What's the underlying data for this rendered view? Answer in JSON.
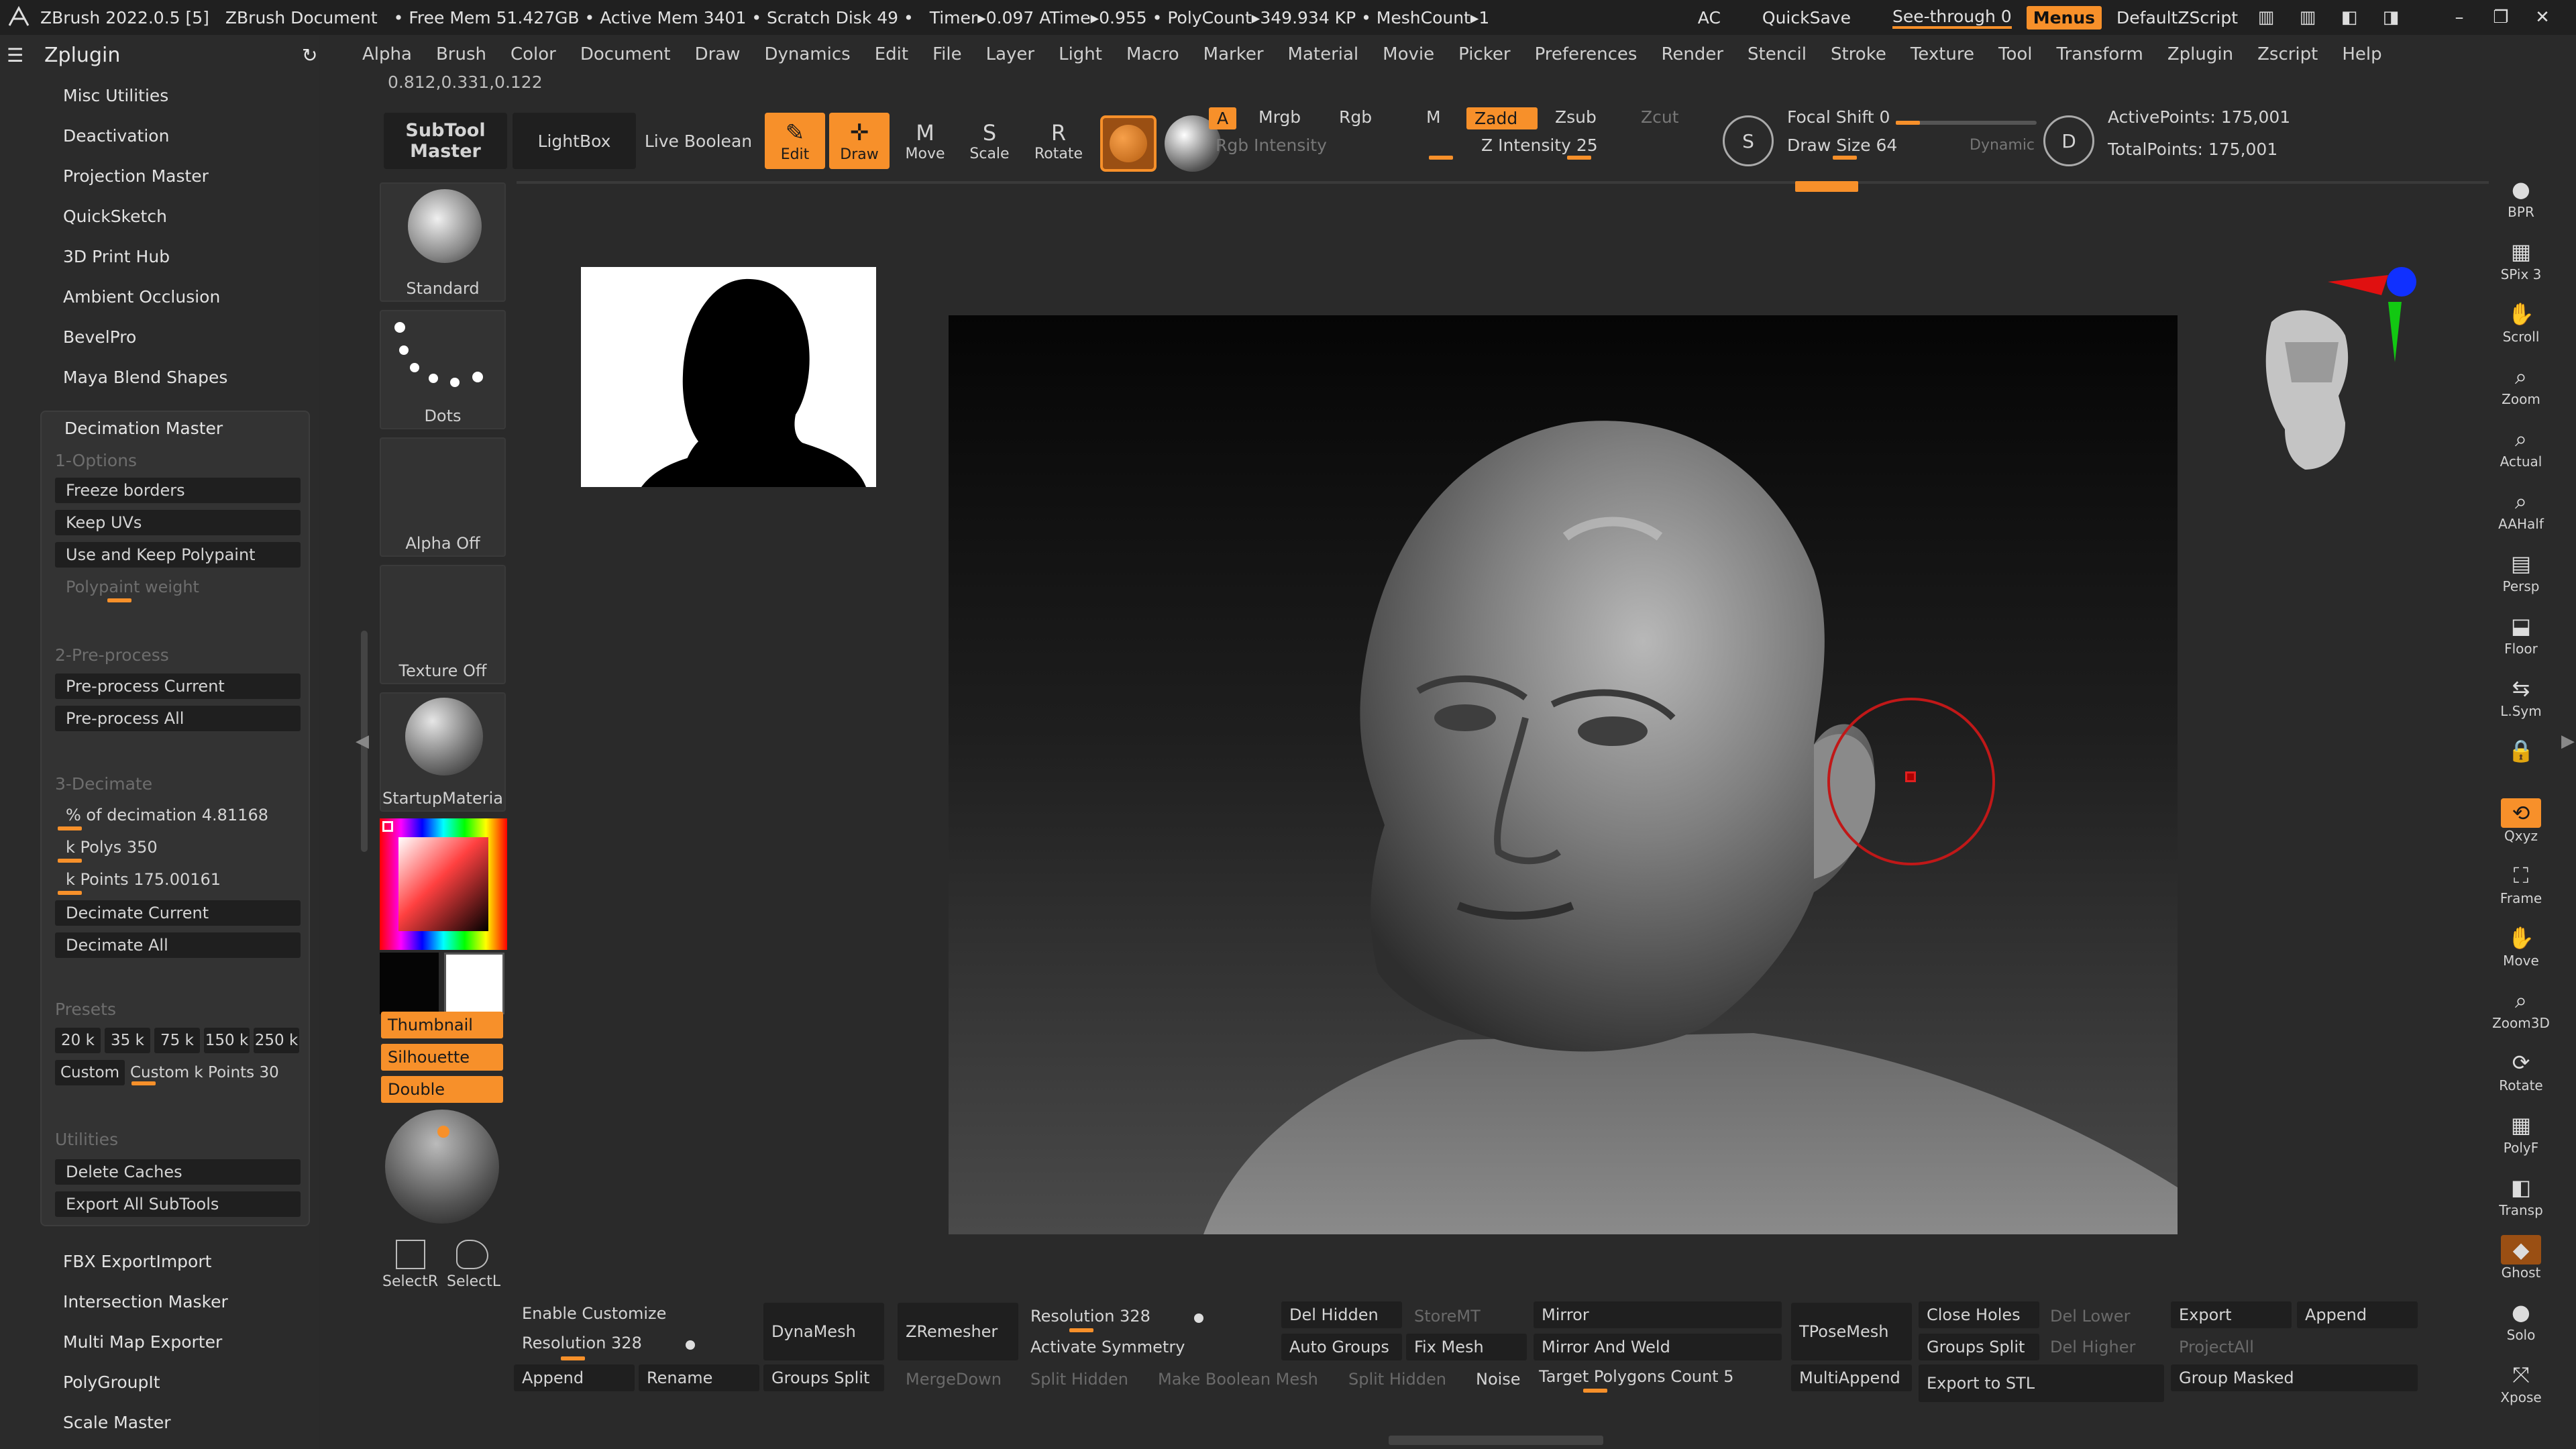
{
  "titlebar": {
    "app": "ZBrush 2022.0.5 [5]",
    "doc": "ZBrush Document",
    "stats": "• Free Mem 51.427GB • Active Mem 3401 • Scratch Disk 49 •",
    "timer": "Timer▸0.097 ATime▸0.955 • PolyCount▸349.934 KP • MeshCount▸1",
    "ac": "AC",
    "quicksave": "QuickSave",
    "seethrough": "See-through  0",
    "menus": "Menus",
    "script": "DefaultZScript"
  },
  "menubar": [
    "Alpha",
    "Brush",
    "Color",
    "Document",
    "Draw",
    "Dynamics",
    "Edit",
    "File",
    "Layer",
    "Light",
    "Macro",
    "Marker",
    "Material",
    "Movie",
    "Picker",
    "Preferences",
    "Render",
    "Stencil",
    "Stroke",
    "Texture",
    "Tool",
    "Transform",
    "Zplugin",
    "Zscript",
    "Help"
  ],
  "coord_readout": "0.812,0.331,0.122",
  "left_panel": {
    "title": "Zplugin",
    "items": [
      "Misc Utilities",
      "Deactivation",
      "Projection Master",
      "QuickSketch",
      "3D Print Hub",
      "Ambient Occlusion",
      "BevelPro",
      "Maya Blend Shapes"
    ],
    "decimation": {
      "title": "Decimation Master",
      "s1": "1-Options",
      "freeze": "Freeze borders",
      "keepuv": "Keep UVs",
      "polypaint": "Use and Keep Polypaint",
      "ppweight": "Polypaint weight",
      "s2": "2-Pre-process",
      "pre_current": "Pre-process Current",
      "pre_all": "Pre-process All",
      "s3": "3-Decimate",
      "pct": "% of decimation 4.81168",
      "kpolys": "k Polys 350",
      "kpoints": "k Points 175.00161",
      "dec_current": "Decimate Current",
      "dec_all": "Decimate All",
      "s_presets": "Presets",
      "presets": [
        "20 k",
        "35 k",
        "75 k",
        "150 k",
        "250 k"
      ],
      "custom": "Custom",
      "custom_points": "Custom k Points 30",
      "s_util": "Utilities",
      "del_caches": "Delete Caches",
      "export_all": "Export All SubTools"
    },
    "bottom_items": [
      "FBX ExportImport",
      "Intersection Masker",
      "Multi Map Exporter",
      "PolyGroupIt",
      "Scale Master"
    ]
  },
  "toolbar": {
    "subtool_master": "SubTool\nMaster",
    "lightbox": "LightBox",
    "live_boolean": "Live Boolean",
    "edit": "Edit",
    "draw": "Draw",
    "move": "Move",
    "scale": "Scale",
    "rotate": "Rotate",
    "a": "A",
    "mrgb": "Mrgb",
    "rgb": "Rgb",
    "m": "M",
    "zadd": "Zadd",
    "zsub": "Zsub",
    "zcut": "Zcut",
    "rgb_intensity": "Rgb Intensity",
    "z_intensity": "Z Intensity 25",
    "focal_shift": "Focal Shift 0",
    "draw_size": "Draw Size 64",
    "dynamic": "Dynamic",
    "active_points": "ActivePoints: 175,001",
    "total_points": "TotalPoints: 175,001"
  },
  "tool_column": {
    "standard": "Standard",
    "dots": "Dots",
    "alpha_off": "Alpha Off",
    "texture_off": "Texture Off",
    "material": "StartupMateria",
    "thumbnail": "Thumbnail",
    "silhouette": "Silhouette",
    "double": "Double",
    "selectr": "SelectR",
    "selectl": "SelectL"
  },
  "right_column": [
    {
      "icon": "bpr-icon",
      "label": "BPR"
    },
    {
      "icon": "spix-icon",
      "label": "SPix 3"
    },
    {
      "icon": "scroll-icon",
      "label": "Scroll"
    },
    {
      "icon": "zoom-icon",
      "label": "Zoom"
    },
    {
      "icon": "actual-icon",
      "label": "Actual"
    },
    {
      "icon": "aahalf-icon",
      "label": "AAHalf"
    },
    {
      "icon": "persp-icon",
      "label": "Persp"
    },
    {
      "icon": "floor-icon",
      "label": "Floor"
    },
    {
      "icon": "lsym-icon",
      "label": "L.Sym"
    },
    {
      "icon": "lock-icon",
      "label": ""
    },
    {
      "icon": "xyz-icon",
      "label": "Qxyz"
    },
    {
      "icon": "frame-icon",
      "label": "Frame"
    },
    {
      "icon": "move-icon",
      "label": "Move"
    },
    {
      "icon": "zoom3d-icon",
      "label": "Zoom3D"
    },
    {
      "icon": "rotate-icon",
      "label": "Rotate"
    },
    {
      "icon": "polyf-icon",
      "label": "PolyF"
    },
    {
      "icon": "transp-icon",
      "label": "Transp"
    },
    {
      "icon": "ghost-icon",
      "label": "Ghost"
    },
    {
      "icon": "solo-icon",
      "label": "Solo"
    },
    {
      "icon": "xpose-icon",
      "label": "Xpose"
    }
  ],
  "bottom_bar": {
    "enable_customize": "Enable Customize",
    "resolution_left": "Resolution 328",
    "append_left": "Append",
    "rename": "Rename",
    "dynamesh": "DynaMesh",
    "groups_split": "Groups Split",
    "zremesher": "ZRemesher",
    "mergedown": "MergeDown",
    "resolution_mid": "Resolution 328",
    "activate_symmetry": "Activate Symmetry",
    "split_hidden": "Split Hidden",
    "make_boolean": "Make Boolean Mesh",
    "split_hidden2": "Split Hidden",
    "del_hidden": "Del Hidden",
    "storemt": "StoreMT",
    "auto_groups": "Auto Groups",
    "fix_mesh": "Fix Mesh",
    "noise": "Noise",
    "mirror": "Mirror",
    "mirror_weld": "Mirror And Weld",
    "target_polys": "Target Polygons Count 5",
    "tposemesh": "TPoseMesh",
    "multiappend": "MultiAppend",
    "close_holes": "Close Holes",
    "groups_split2": "Groups Split",
    "export_stl": "Export to STL",
    "del_lower": "Del Lower",
    "del_higher": "Del Higher",
    "export": "Export",
    "projectall": "ProjectAll",
    "append_right": "Append",
    "group_masked": "Group Masked"
  },
  "colors": {
    "accent": "#f7902a",
    "bg": "#2a2a2a",
    "dark": "#1f1f1f"
  }
}
